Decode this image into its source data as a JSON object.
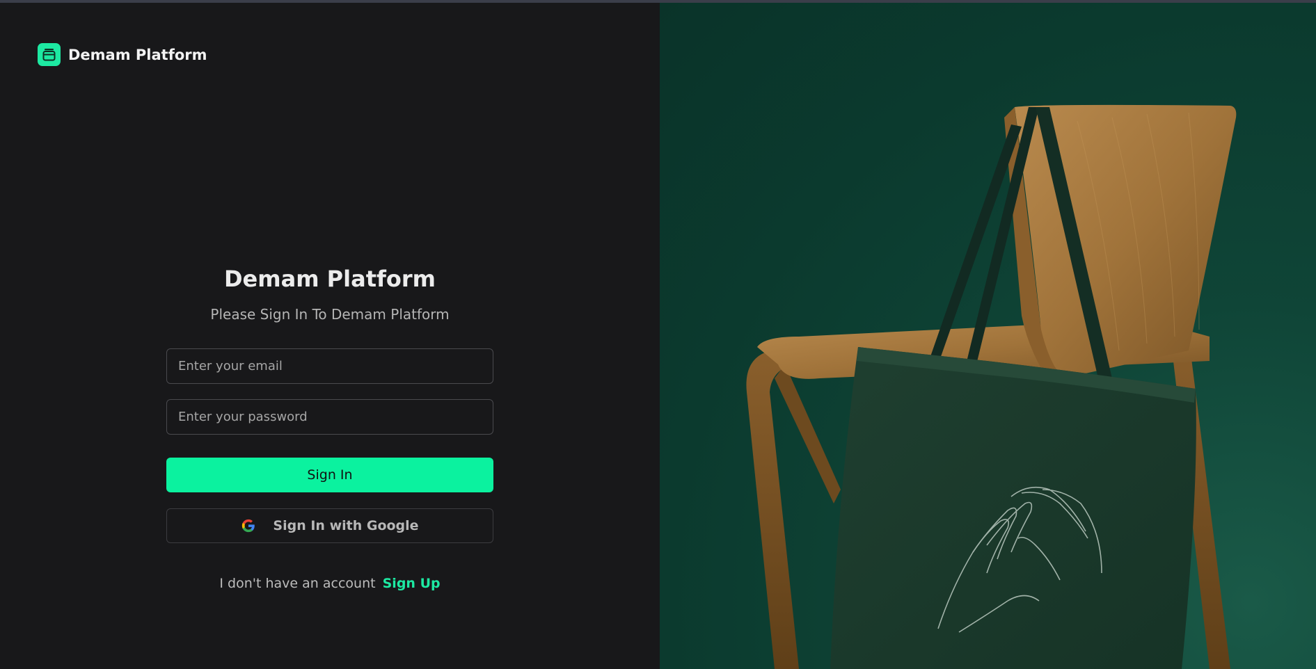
{
  "brand": {
    "name": "Demam Platform",
    "logo_icon": "box-icon",
    "accent": "#1de9a2"
  },
  "form": {
    "title": "Demam Platform",
    "subtitle": "Please Sign In To Demam Platform",
    "email_placeholder": "Enter your email",
    "password_placeholder": "Enter your password",
    "signin_label": "Sign In",
    "google_label": "Sign In with Google",
    "no_account_text": "I don't have an account",
    "signup_label": "Sign Up"
  },
  "colors": {
    "background": "#18181a",
    "primary": "#0bf29f",
    "image_bg": "#0b3a2e"
  }
}
